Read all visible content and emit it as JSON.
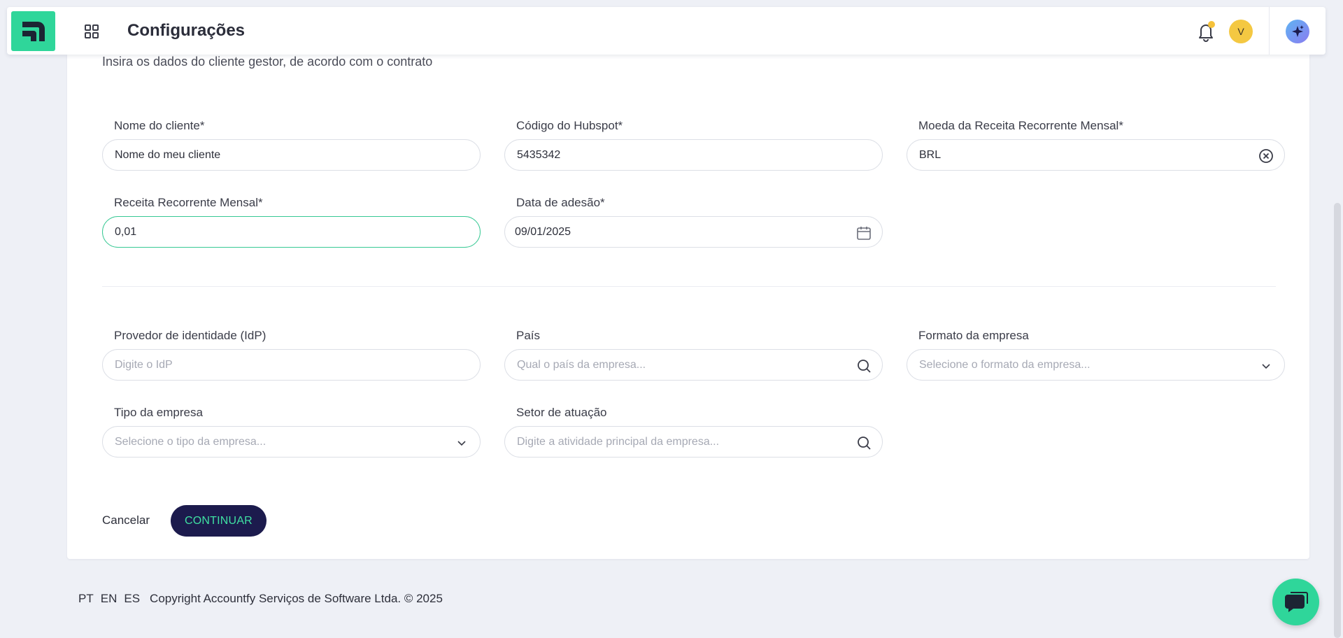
{
  "header": {
    "title": "Configurações",
    "avatar_initial": "V",
    "icons": {
      "logo": "brand-logo-icon",
      "apps": "grid-icon",
      "notifications": "bell-icon",
      "ai": "sparkle-icon"
    }
  },
  "form": {
    "subtitle": "Insira os dados do cliente gestor, de acordo com o contrato",
    "client_name": {
      "label": "Nome do cliente*",
      "value": "Nome do meu cliente"
    },
    "hubspot_code": {
      "label": "Código do Hubspot*",
      "value": "5435342"
    },
    "mrr_currency": {
      "label": "Moeda da Receita Recorrente Mensal*",
      "value": "BRL"
    },
    "mrr": {
      "label": "Receita Recorrente Mensal*",
      "value": "0,01"
    },
    "join_date": {
      "label": "Data de adesão*",
      "value": "09/01/2025"
    },
    "idp": {
      "label": "Provedor de identidade (IdP)",
      "placeholder": "Digite o IdP"
    },
    "country": {
      "label": "País",
      "placeholder": "Qual o país da empresa..."
    },
    "company_format": {
      "label": "Formato da empresa",
      "placeholder": "Selecione o formato da empresa..."
    },
    "company_type": {
      "label": "Tipo da empresa",
      "placeholder": "Selecione o tipo da empresa..."
    },
    "sector": {
      "label": "Setor de atuação",
      "placeholder": "Digite a atividade principal da empresa..."
    },
    "cancel_label": "Cancelar",
    "continue_label": "CONTINUAR"
  },
  "footer": {
    "languages": [
      "PT",
      "EN",
      "ES"
    ],
    "copyright": "Copyright Accountfy Serviços de Software Ltda. © 2025"
  },
  "colors": {
    "accent_green": "#2fd69a",
    "primary_navy": "#1c1b4d",
    "focus_border": "#38c994"
  }
}
